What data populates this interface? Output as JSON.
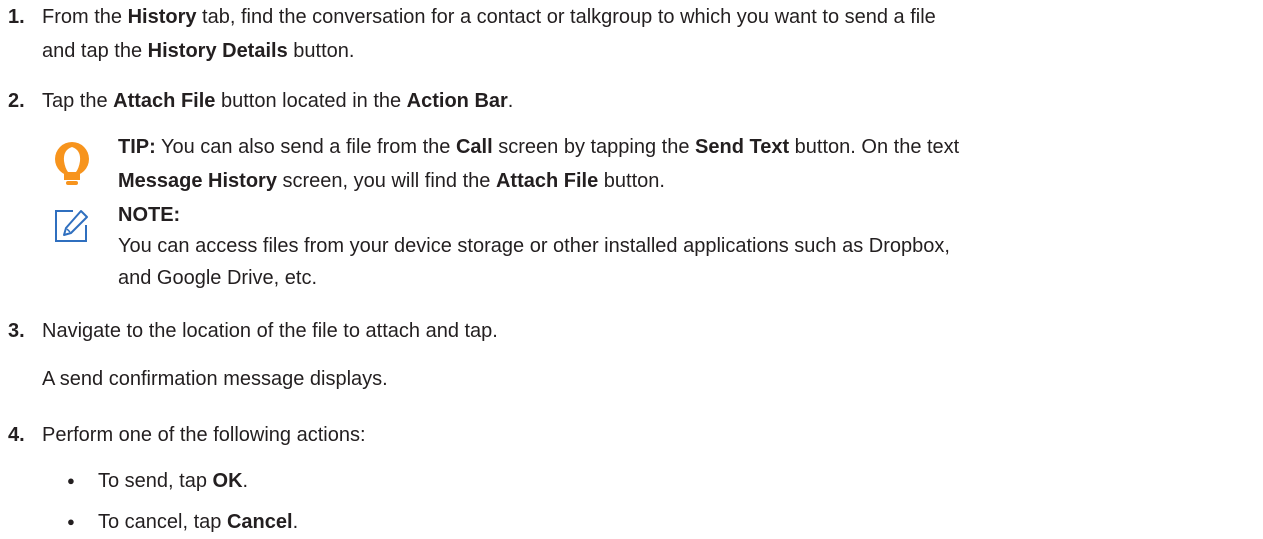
{
  "colors": {
    "text": "#231f20",
    "tip_icon": "#f7941d",
    "note_icon": "#2f6fbf"
  },
  "icons": {
    "tip": "lightbulb-icon",
    "note": "pencil-note-icon"
  },
  "steps": [
    {
      "number": "1.",
      "t1": "From the ",
      "b1": "History",
      "t2": " tab, find the conversation for a contact or talkgroup to which you want to send a file",
      "t3": "and tap the ",
      "b2": "History Details",
      "t4": " button."
    },
    {
      "number": "2.",
      "t1": "Tap the ",
      "b1": "Attach File",
      "t2": " button located in the ",
      "b2": "Action Bar",
      "t3": "."
    },
    {
      "number": "3.",
      "t1": "Navigate to the location of the file to attach and tap.",
      "result": "A send confirmation message displays."
    },
    {
      "number": "4.",
      "t1": "Perform one of the following actions:",
      "bullet_char": "●",
      "bullets": [
        {
          "t1": "To send, tap ",
          "b1": "OK",
          "t2": "."
        },
        {
          "t1": "To cancel, tap ",
          "b1": "Cancel",
          "t2": "."
        }
      ]
    }
  ],
  "tip": {
    "label": "TIP:",
    "t1": " You can also send a file from the ",
    "b1": "Call",
    "t2": " screen by tapping the ",
    "b2": "Send Text",
    "t3": " button. On the text",
    "b3": "Message History",
    "t4": " screen, you will find the ",
    "b4": "Attach File",
    "t5": " button."
  },
  "note": {
    "label": "NOTE:",
    "line1": "You can access files from your device storage or other installed applications such as Dropbox,",
    "line2": "and Google Drive, etc."
  }
}
